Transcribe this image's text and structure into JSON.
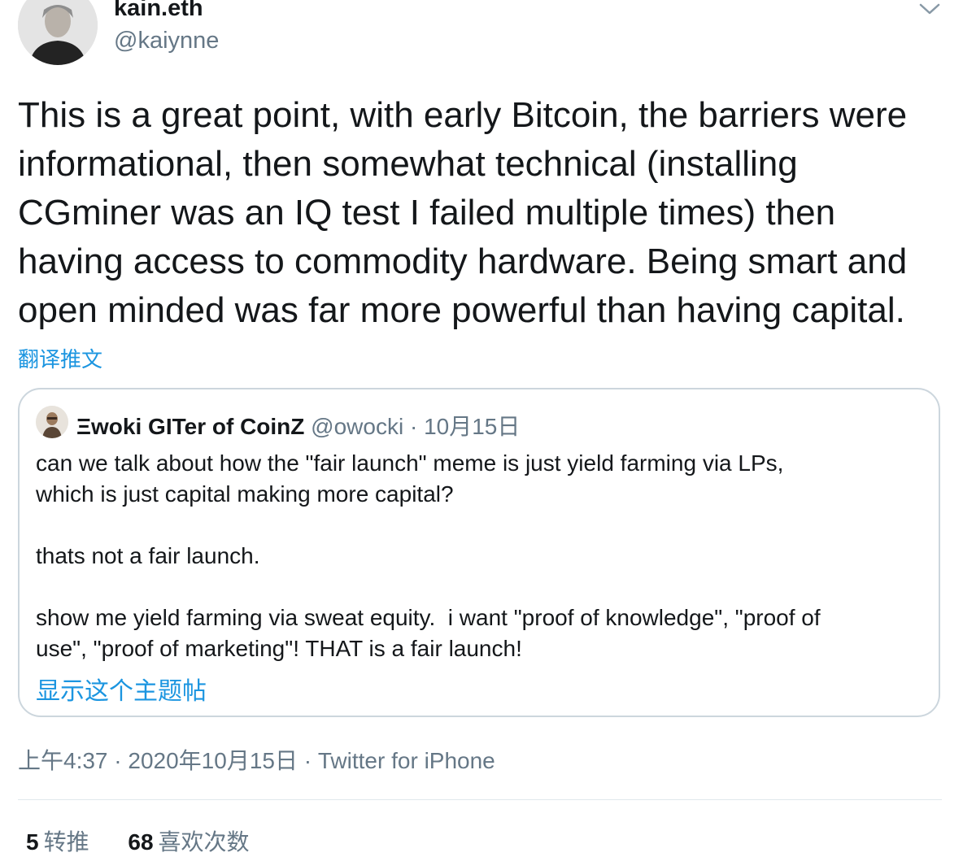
{
  "author": {
    "name": "kain.eth",
    "handle": "@kaiynne"
  },
  "tweet": {
    "lines": [
      "This is a great point, with early Bitcoin, the barriers were",
      "informational, then somewhat technical (installing",
      "CGminer was an IQ test I failed multiple times) then",
      "having access to commodity hardware. Being smart and",
      "open minded was far more powerful than having capital."
    ],
    "translate_label": "翻译推文"
  },
  "quote": {
    "name": "Ξwoki GITer of CoinZ",
    "handle": "@owocki",
    "separator": " · ",
    "date": "10月15日",
    "lines": [
      "can we talk about how the \"fair launch\" meme is just yield farming via LPs,",
      "which is just capital making more capital?",
      "",
      "thats not a fair launch.",
      "",
      "show me yield farming via sweat equity.  i want \"proof of knowledge\", \"proof of",
      "use\", \"proof of marketing\"! THAT is a fair launch!"
    ],
    "show_thread_label": "显示这个主题帖"
  },
  "meta": {
    "time": "上午4:37",
    "date": "2020年10月15日",
    "separator": " · ",
    "source": "Twitter for iPhone"
  },
  "stats": {
    "retweets_count": "5",
    "retweets_label": "转推",
    "likes_count": "68",
    "likes_label": "喜欢次数"
  },
  "colors": {
    "link": "#1b95e0",
    "muted": "#657786",
    "border": "#ccd6dd"
  },
  "icons": {
    "caret": "chevron-down-icon"
  }
}
